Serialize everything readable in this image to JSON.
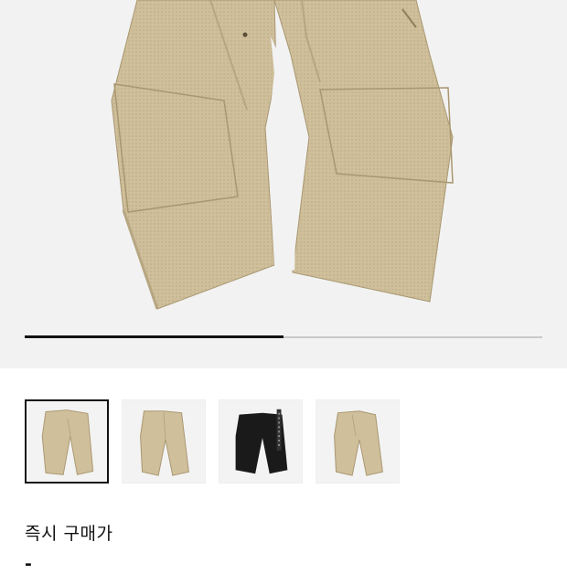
{
  "gallery": {
    "current_index": 1,
    "total": 4,
    "progress_fraction": 0.5,
    "thumbnails": [
      {
        "icon": "khaki-pants-front-icon",
        "selected": true
      },
      {
        "icon": "khaki-pants-back-icon",
        "selected": false
      },
      {
        "icon": "black-pants-icon",
        "selected": false
      },
      {
        "icon": "khaki-pants-side-icon",
        "selected": false
      }
    ]
  },
  "colors": {
    "khaki": "#cfbf9b",
    "khaki_shadow": "#b7a682",
    "black_pants": "#1a1a1a",
    "accent": "#111111"
  },
  "purchase": {
    "label": "즉시 구매가",
    "value": "-"
  }
}
